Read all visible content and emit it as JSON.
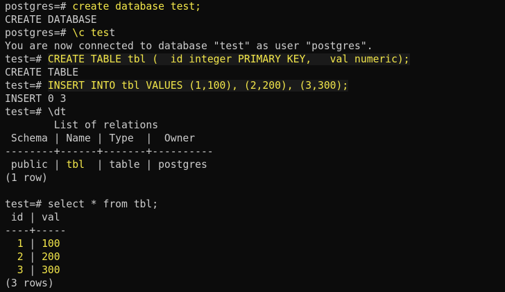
{
  "lines": [
    {
      "segments": [
        {
          "text": "postgres=# ",
          "color": "#cccccc"
        },
        {
          "text": "create database test;",
          "color": "#f2e64a"
        }
      ]
    },
    {
      "segments": [
        {
          "text": "CREATE DATABASE",
          "color": "#cccccc"
        }
      ]
    },
    {
      "segments": [
        {
          "text": "postgres=# ",
          "color": "#cccccc"
        },
        {
          "text": "\\c tes",
          "color": "#f2e64a"
        },
        {
          "text": "t",
          "color": "#cccccc"
        }
      ]
    },
    {
      "segments": [
        {
          "text": "You are now connected to database \"test\" as user \"postgres\".",
          "color": "#cccccc"
        }
      ]
    },
    {
      "segments": [
        {
          "text": "test=# ",
          "color": "#cccccc"
        },
        {
          "text": "CREATE TABLE tbl (  id integer PRIMARY KEY,   val numeric);",
          "color": "#f2e64a",
          "highlight": true
        }
      ]
    },
    {
      "segments": [
        {
          "text": "CREATE TABLE",
          "color": "#cccccc"
        }
      ]
    },
    {
      "segments": [
        {
          "text": "test=# ",
          "color": "#cccccc"
        },
        {
          "text": "INSERT INTO tbl VALUES (1,100), (2,200), (3,300);",
          "color": "#f2e64a",
          "highlight": true
        }
      ]
    },
    {
      "segments": [
        {
          "text": "INSERT 0 3",
          "color": "#cccccc"
        }
      ]
    },
    {
      "segments": [
        {
          "text": "test=# \\dt",
          "color": "#cccccc"
        }
      ]
    },
    {
      "segments": [
        {
          "text": "        List of relations",
          "color": "#cccccc"
        }
      ]
    },
    {
      "segments": [
        {
          "text": " Schema | Name | Type  |  Owner",
          "color": "#cccccc"
        }
      ]
    },
    {
      "segments": [
        {
          "text": "--------+------+-------+----------",
          "color": "#cccccc"
        }
      ]
    },
    {
      "segments": [
        {
          "text": " public | ",
          "color": "#cccccc"
        },
        {
          "text": "tbl",
          "color": "#f2e64a"
        },
        {
          "text": "  | table | postgres",
          "color": "#cccccc"
        }
      ]
    },
    {
      "segments": [
        {
          "text": "(1 row)",
          "color": "#cccccc"
        }
      ]
    },
    {
      "segments": [
        {
          "text": "",
          "color": "#cccccc"
        }
      ]
    },
    {
      "segments": [
        {
          "text": "test=# select * from tbl;",
          "color": "#cccccc"
        }
      ]
    },
    {
      "segments": [
        {
          "text": " id | val",
          "color": "#cccccc"
        }
      ]
    },
    {
      "segments": [
        {
          "text": "----+-----",
          "color": "#cccccc"
        }
      ]
    },
    {
      "segments": [
        {
          "text": "  ",
          "color": "#cccccc"
        },
        {
          "text": "1",
          "color": "#f2e64a"
        },
        {
          "text": " | ",
          "color": "#cccccc"
        },
        {
          "text": "100",
          "color": "#f2e64a"
        }
      ]
    },
    {
      "segments": [
        {
          "text": "  ",
          "color": "#cccccc"
        },
        {
          "text": "2",
          "color": "#f2e64a"
        },
        {
          "text": " | ",
          "color": "#cccccc"
        },
        {
          "text": "200",
          "color": "#f2e64a"
        }
      ]
    },
    {
      "segments": [
        {
          "text": "  ",
          "color": "#cccccc"
        },
        {
          "text": "3",
          "color": "#f2e64a"
        },
        {
          "text": " | ",
          "color": "#cccccc"
        },
        {
          "text": "300",
          "color": "#f2e64a"
        }
      ]
    },
    {
      "segments": [
        {
          "text": "(3 rows)",
          "color": "#cccccc"
        }
      ]
    }
  ]
}
